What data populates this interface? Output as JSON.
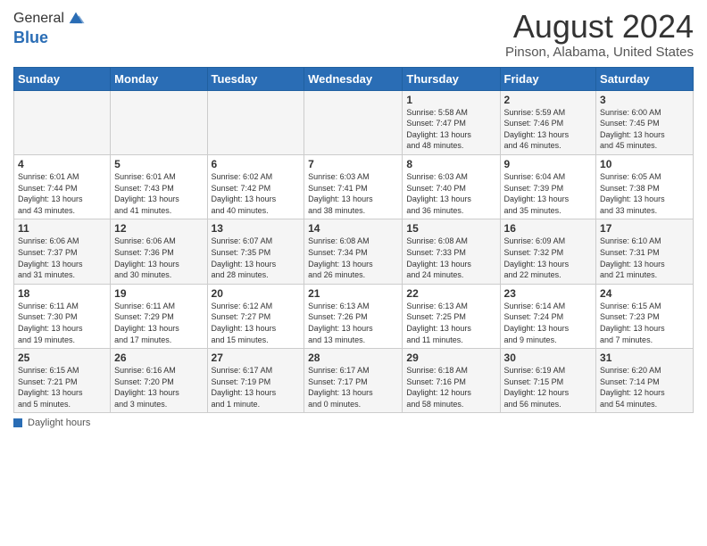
{
  "logo": {
    "line1": "General",
    "line2": "Blue"
  },
  "title": "August 2024",
  "subtitle": "Pinson, Alabama, United States",
  "days_of_week": [
    "Sunday",
    "Monday",
    "Tuesday",
    "Wednesday",
    "Thursday",
    "Friday",
    "Saturday"
  ],
  "weeks": [
    [
      {
        "num": "",
        "info": ""
      },
      {
        "num": "",
        "info": ""
      },
      {
        "num": "",
        "info": ""
      },
      {
        "num": "",
        "info": ""
      },
      {
        "num": "1",
        "info": "Sunrise: 5:58 AM\nSunset: 7:47 PM\nDaylight: 13 hours\nand 48 minutes."
      },
      {
        "num": "2",
        "info": "Sunrise: 5:59 AM\nSunset: 7:46 PM\nDaylight: 13 hours\nand 46 minutes."
      },
      {
        "num": "3",
        "info": "Sunrise: 6:00 AM\nSunset: 7:45 PM\nDaylight: 13 hours\nand 45 minutes."
      }
    ],
    [
      {
        "num": "4",
        "info": "Sunrise: 6:01 AM\nSunset: 7:44 PM\nDaylight: 13 hours\nand 43 minutes."
      },
      {
        "num": "5",
        "info": "Sunrise: 6:01 AM\nSunset: 7:43 PM\nDaylight: 13 hours\nand 41 minutes."
      },
      {
        "num": "6",
        "info": "Sunrise: 6:02 AM\nSunset: 7:42 PM\nDaylight: 13 hours\nand 40 minutes."
      },
      {
        "num": "7",
        "info": "Sunrise: 6:03 AM\nSunset: 7:41 PM\nDaylight: 13 hours\nand 38 minutes."
      },
      {
        "num": "8",
        "info": "Sunrise: 6:03 AM\nSunset: 7:40 PM\nDaylight: 13 hours\nand 36 minutes."
      },
      {
        "num": "9",
        "info": "Sunrise: 6:04 AM\nSunset: 7:39 PM\nDaylight: 13 hours\nand 35 minutes."
      },
      {
        "num": "10",
        "info": "Sunrise: 6:05 AM\nSunset: 7:38 PM\nDaylight: 13 hours\nand 33 minutes."
      }
    ],
    [
      {
        "num": "11",
        "info": "Sunrise: 6:06 AM\nSunset: 7:37 PM\nDaylight: 13 hours\nand 31 minutes."
      },
      {
        "num": "12",
        "info": "Sunrise: 6:06 AM\nSunset: 7:36 PM\nDaylight: 13 hours\nand 30 minutes."
      },
      {
        "num": "13",
        "info": "Sunrise: 6:07 AM\nSunset: 7:35 PM\nDaylight: 13 hours\nand 28 minutes."
      },
      {
        "num": "14",
        "info": "Sunrise: 6:08 AM\nSunset: 7:34 PM\nDaylight: 13 hours\nand 26 minutes."
      },
      {
        "num": "15",
        "info": "Sunrise: 6:08 AM\nSunset: 7:33 PM\nDaylight: 13 hours\nand 24 minutes."
      },
      {
        "num": "16",
        "info": "Sunrise: 6:09 AM\nSunset: 7:32 PM\nDaylight: 13 hours\nand 22 minutes."
      },
      {
        "num": "17",
        "info": "Sunrise: 6:10 AM\nSunset: 7:31 PM\nDaylight: 13 hours\nand 21 minutes."
      }
    ],
    [
      {
        "num": "18",
        "info": "Sunrise: 6:11 AM\nSunset: 7:30 PM\nDaylight: 13 hours\nand 19 minutes."
      },
      {
        "num": "19",
        "info": "Sunrise: 6:11 AM\nSunset: 7:29 PM\nDaylight: 13 hours\nand 17 minutes."
      },
      {
        "num": "20",
        "info": "Sunrise: 6:12 AM\nSunset: 7:27 PM\nDaylight: 13 hours\nand 15 minutes."
      },
      {
        "num": "21",
        "info": "Sunrise: 6:13 AM\nSunset: 7:26 PM\nDaylight: 13 hours\nand 13 minutes."
      },
      {
        "num": "22",
        "info": "Sunrise: 6:13 AM\nSunset: 7:25 PM\nDaylight: 13 hours\nand 11 minutes."
      },
      {
        "num": "23",
        "info": "Sunrise: 6:14 AM\nSunset: 7:24 PM\nDaylight: 13 hours\nand 9 minutes."
      },
      {
        "num": "24",
        "info": "Sunrise: 6:15 AM\nSunset: 7:23 PM\nDaylight: 13 hours\nand 7 minutes."
      }
    ],
    [
      {
        "num": "25",
        "info": "Sunrise: 6:15 AM\nSunset: 7:21 PM\nDaylight: 13 hours\nand 5 minutes."
      },
      {
        "num": "26",
        "info": "Sunrise: 6:16 AM\nSunset: 7:20 PM\nDaylight: 13 hours\nand 3 minutes."
      },
      {
        "num": "27",
        "info": "Sunrise: 6:17 AM\nSunset: 7:19 PM\nDaylight: 13 hours\nand 1 minute."
      },
      {
        "num": "28",
        "info": "Sunrise: 6:17 AM\nSunset: 7:17 PM\nDaylight: 13 hours\nand 0 minutes."
      },
      {
        "num": "29",
        "info": "Sunrise: 6:18 AM\nSunset: 7:16 PM\nDaylight: 12 hours\nand 58 minutes."
      },
      {
        "num": "30",
        "info": "Sunrise: 6:19 AM\nSunset: 7:15 PM\nDaylight: 12 hours\nand 56 minutes."
      },
      {
        "num": "31",
        "info": "Sunrise: 6:20 AM\nSunset: 7:14 PM\nDaylight: 12 hours\nand 54 minutes."
      }
    ]
  ],
  "footer": {
    "label": "Daylight hours"
  }
}
